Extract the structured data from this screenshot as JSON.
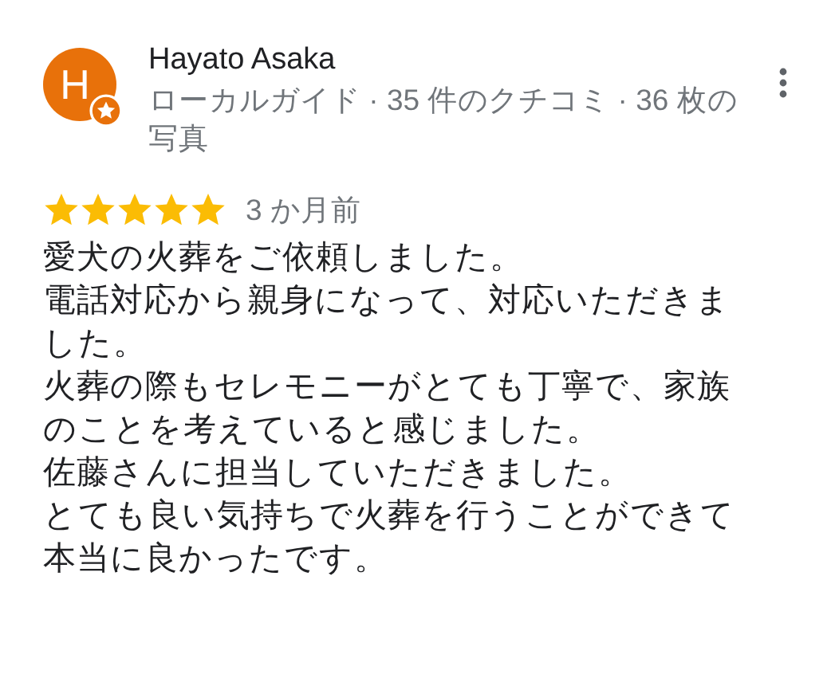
{
  "review": {
    "author": {
      "initial": "H",
      "name": "Hayato Asaka",
      "local_guide": true,
      "meta": "ローカルガイド · 35 件のクチコミ · 36 枚の写真"
    },
    "stars": 5,
    "time": "3 か月前",
    "paragraphs": [
      "愛犬の火葬をご依頼しました。",
      "電話対応から親身になって、対応いただきました。",
      "火葬の際もセレモニーがとても丁寧で、家族のことを考えていると感じました。",
      "佐藤さんに担当していただきました。",
      "とても良い気持ちで火葬を行うことができて本当に良かったです。"
    ]
  }
}
